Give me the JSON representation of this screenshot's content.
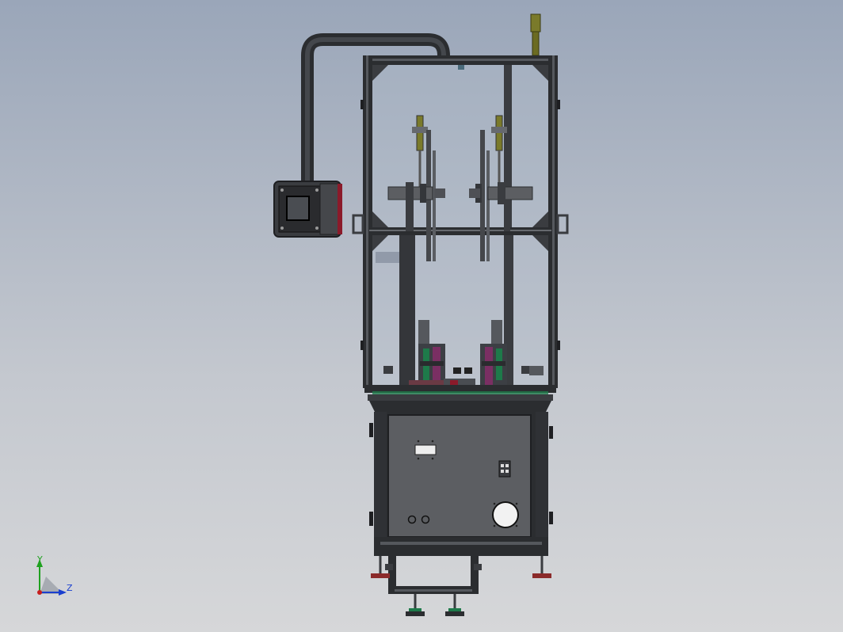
{
  "view": {
    "background_top": "#9aa6b9",
    "background_bottom": "#d6d7d9"
  },
  "model": {
    "frame_color": "#2b2d30",
    "panel_color": "#5c5e62",
    "glass_color": "#aeb9c8",
    "accent_green": "#1e7a4a",
    "accent_magenta": "#8a2c6b",
    "accent_olive": "#7a7a2a",
    "accent_red": "#8b1a2a"
  },
  "triad": {
    "y_label": "Y",
    "z_label": "Z",
    "y_color": "#1fa11f",
    "z_color": "#1a3fcf",
    "origin_color": "#c81e1e"
  }
}
